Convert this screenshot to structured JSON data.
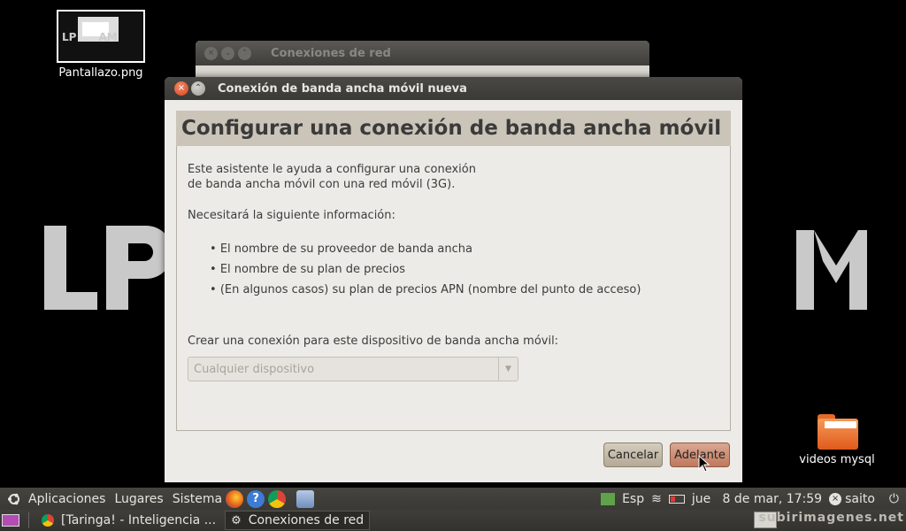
{
  "desktop": {
    "screenshot_icon": {
      "label": "Pantallazo.png"
    },
    "folder_icon": {
      "label": "videos mysql"
    }
  },
  "background_window": {
    "title": "Conexiones de red"
  },
  "dialog": {
    "title": "Conexión de banda ancha móvil nueva",
    "heading": "Configurar una conexión de banda ancha móvil",
    "intro_line1": "Este asistente le ayuda a configurar una conexión",
    "intro_line2": "de banda ancha móvil con una red móvil (3G).",
    "info_needed": "Necesitará la siguiente información:",
    "bullets": [
      "El nombre de su proveedor de banda ancha",
      "El nombre de su plan de precios",
      "(En algunos casos) su plan de precios APN (nombre del punto de acceso)"
    ],
    "device_label": "Crear una conexión para este dispositivo de banda ancha móvil:",
    "device_select": {
      "selected": "Cualquier dispositivo"
    },
    "cancel_label": "Cancelar",
    "next_label": "Adelante"
  },
  "top_panel": {
    "menus": [
      "Aplicaciones",
      "Lugares",
      "Sistema"
    ],
    "keyboard_layout": "Esp",
    "clock": "jue   8 de mar, 17:59",
    "user": "saito"
  },
  "bottom_panel": {
    "tasks": [
      "[Taringa! - Inteligencia ...",
      "Conexiones de red"
    ],
    "watermark": "subirimagenes.net"
  },
  "colors": {
    "dialog_bg": "#edebe7",
    "header_band": "#cbc4b8",
    "next_button": "#c0785d",
    "panel": "#3c3b37"
  }
}
